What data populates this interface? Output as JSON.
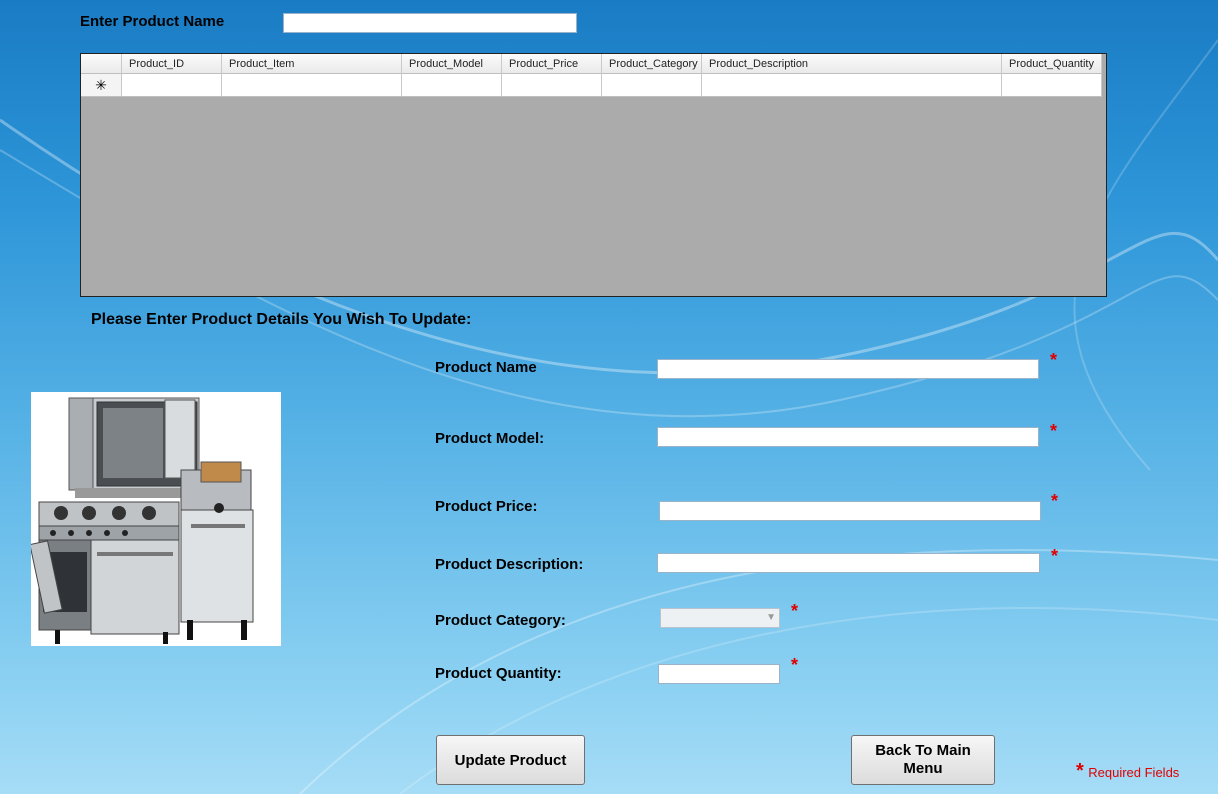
{
  "search": {
    "label": "Enter Product Name",
    "value": ""
  },
  "grid": {
    "new_row_marker": "✳",
    "columns": [
      "Product_ID",
      "Product_Item",
      "Product_Model",
      "Product_Price",
      "Product_Category",
      "Product_Description",
      "Product_Quantity"
    ]
  },
  "form": {
    "instructions": "Please Enter Product Details You Wish To Update:",
    "name_label": "Product Name",
    "model_label": "Product Model:",
    "price_label": "Product Price:",
    "description_label": "Product Description:",
    "category_label": "Product Category:",
    "quantity_label": "Product Quantity:",
    "name_value": "",
    "model_value": "",
    "price_value": "",
    "description_value": "",
    "category_value": "",
    "quantity_value": "",
    "required_marker": "*"
  },
  "buttons": {
    "update": "Update Product",
    "back": "Back To Main Menu"
  },
  "legend": {
    "marker": "*",
    "text": "Required Fields"
  },
  "colors": {
    "required": "#e00000",
    "background_top": "#1a7cc4",
    "background_bottom": "#a6dcf6"
  },
  "icons": {
    "product_image": "commercial-kitchen-equipment-image"
  }
}
